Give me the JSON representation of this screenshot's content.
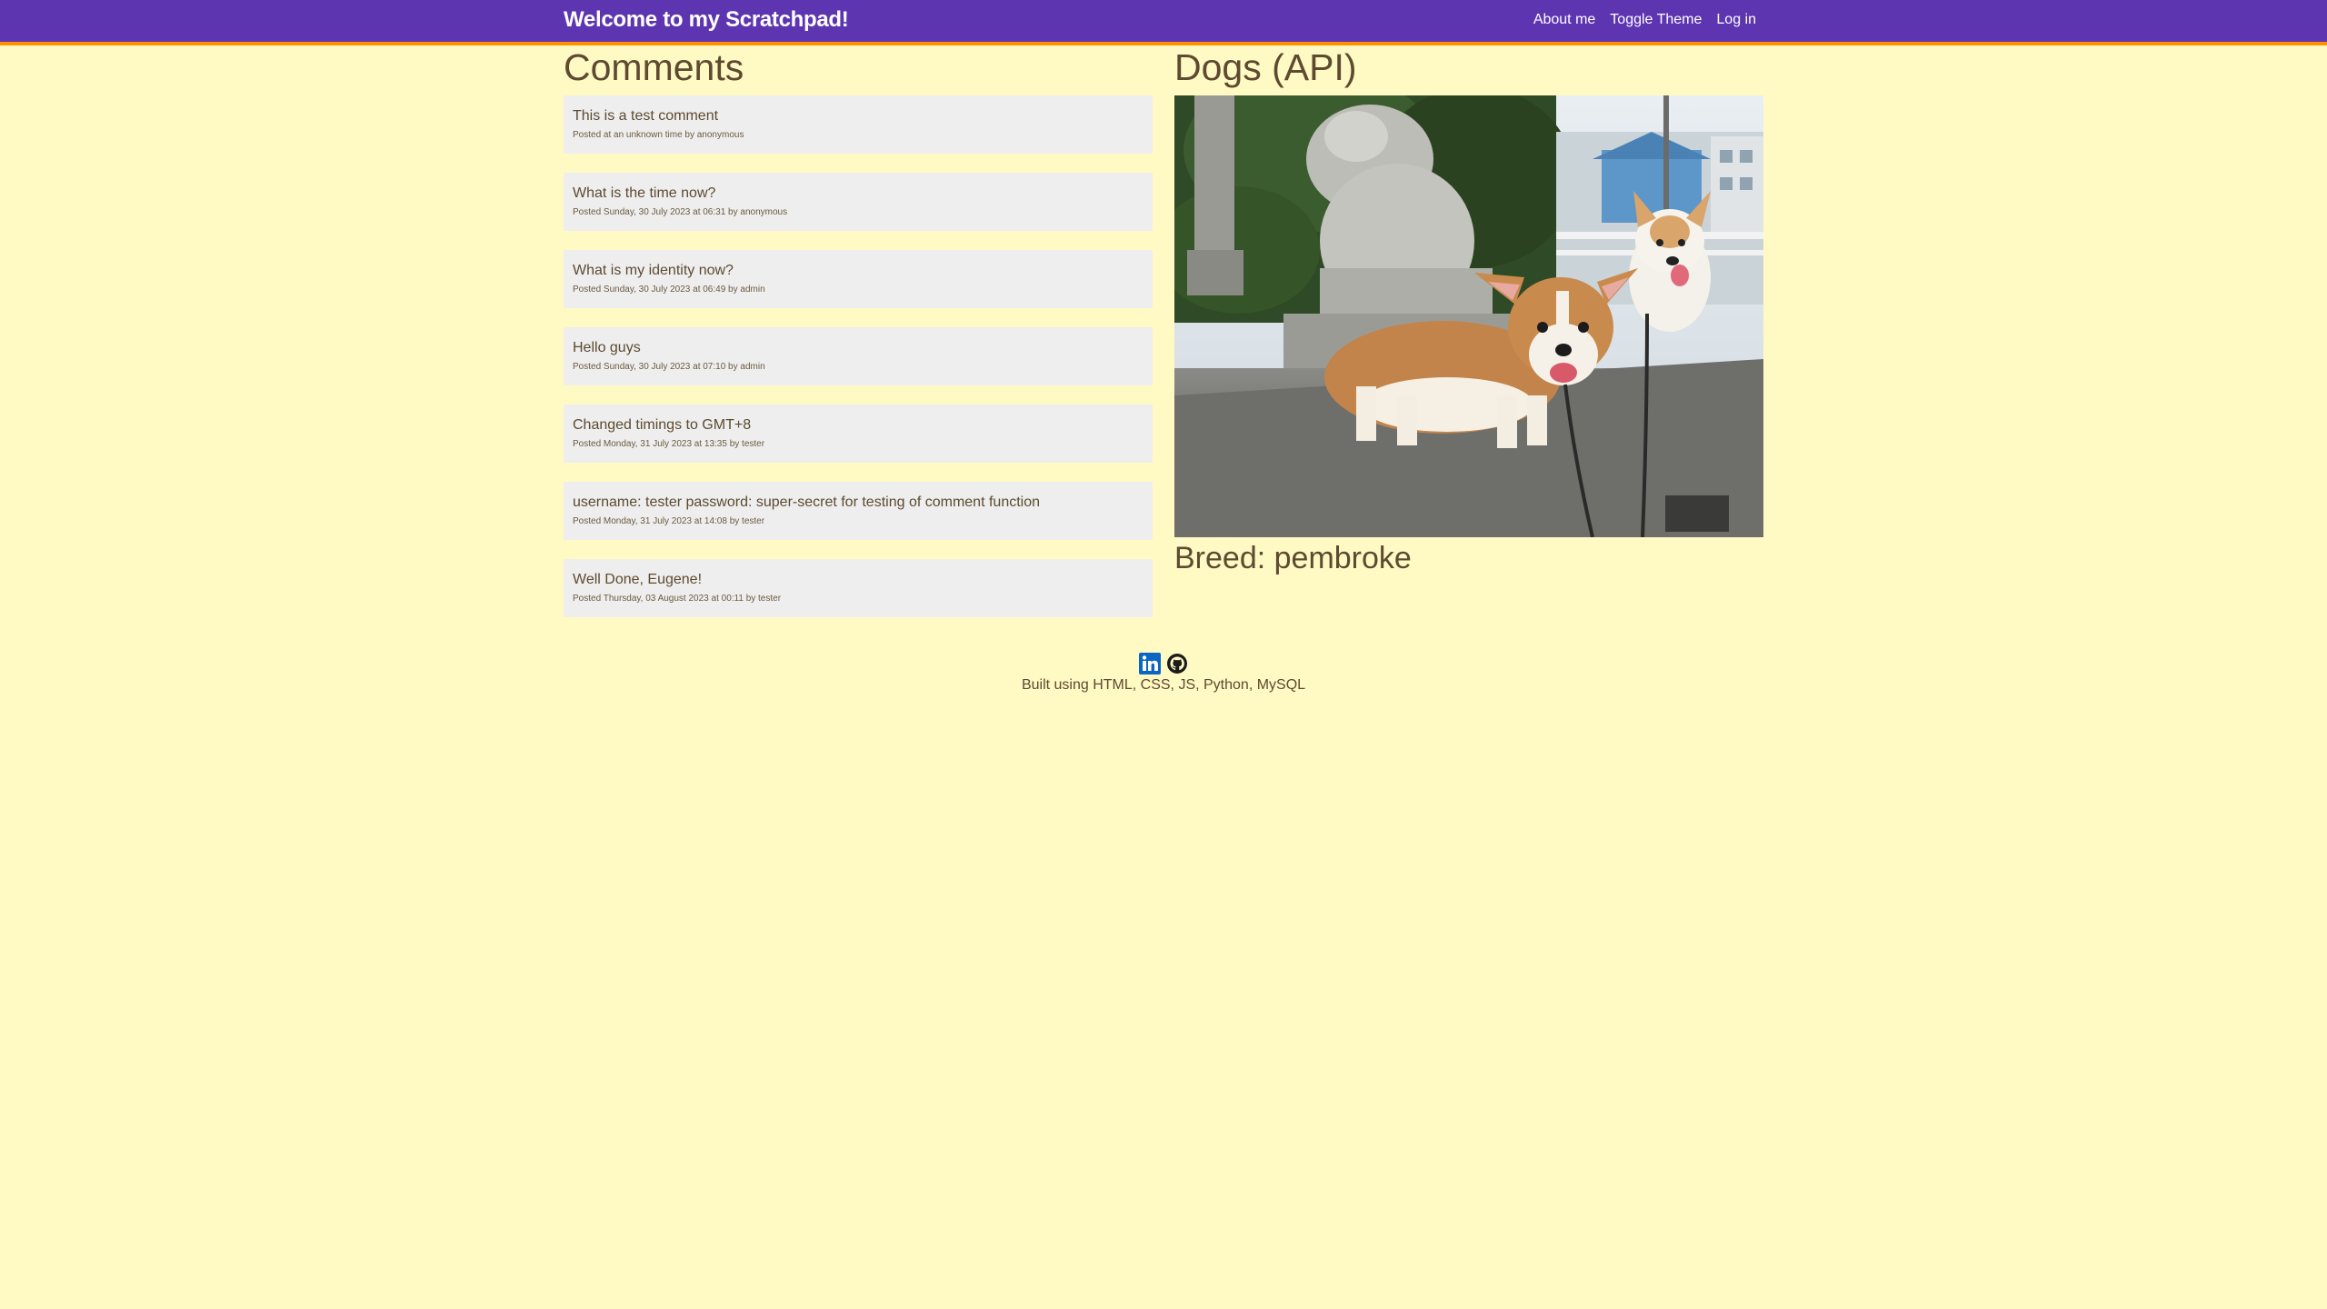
{
  "header": {
    "title": "Welcome to my Scratchpad!",
    "nav": [
      {
        "label": "About me"
      },
      {
        "label": "Toggle Theme"
      },
      {
        "label": "Log in"
      }
    ]
  },
  "comments": {
    "title": "Comments",
    "items": [
      {
        "text": "This is a test comment",
        "meta": "Posted at an unknown time by anonymous"
      },
      {
        "text": "What is the time now?",
        "meta": "Posted Sunday, 30 July 2023 at 06:31 by anonymous"
      },
      {
        "text": "What is my identity now?",
        "meta": "Posted Sunday, 30 July 2023 at 06:49 by admin"
      },
      {
        "text": "Hello guys",
        "meta": "Posted Sunday, 30 July 2023 at 07:10 by admin"
      },
      {
        "text": "Changed timings to GMT+8",
        "meta": "Posted Monday, 31 July 2023 at 13:35 by tester"
      },
      {
        "text": "username: tester password: super-secret for testing of comment function",
        "meta": "Posted Monday, 31 July 2023 at 14:08 by tester"
      },
      {
        "text": "Well Done, Eugene!",
        "meta": "Posted Thursday, 03 August 2023 at 00:11 by tester"
      }
    ]
  },
  "dogs": {
    "title": "Dogs (API)",
    "breed": "Breed: pembroke"
  },
  "footer": {
    "icons": [
      "linkedin-icon",
      "github-icon"
    ],
    "built_with": "Built using HTML, CSS, JS, Python, MySQL"
  },
  "colors": {
    "navbar": "#5e35b1",
    "navbar_accent": "#ff8f00",
    "background": "#fff9c4",
    "comment_card": "#eeeeee",
    "text": "#5d4a30",
    "linkedin": "#0a66c2"
  }
}
